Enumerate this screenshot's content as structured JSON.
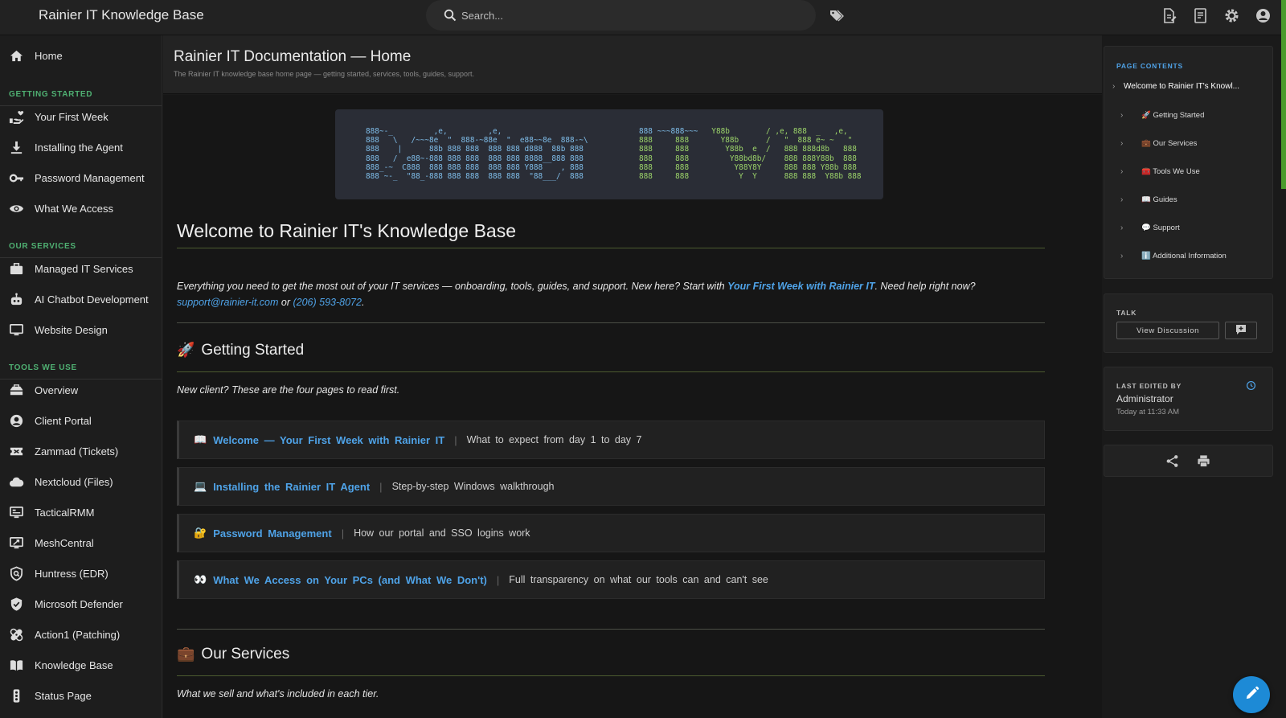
{
  "header": {
    "brand": "Rainier IT Knowledge Base",
    "search_placeholder": "Search...",
    "icons": [
      "search-icon",
      "tag-icon",
      "new-page-icon",
      "page-list-icon",
      "gear-icon",
      "account-icon"
    ]
  },
  "sidebar": {
    "home": "Home",
    "sections": [
      {
        "title": "GETTING STARTED",
        "items": [
          "Your First Week",
          "Installing the Agent",
          "Password Management",
          "What We Access"
        ]
      },
      {
        "title": "OUR SERVICES",
        "items": [
          "Managed IT Services",
          "AI Chatbot Development",
          "Website Design"
        ]
      },
      {
        "title": "TOOLS WE USE",
        "items": [
          "Overview",
          "Client Portal",
          "Zammad (Tickets)",
          "Nextcloud (Files)",
          "TacticalRMM",
          "MeshCentral",
          "Huntress (EDR)",
          "Microsoft Defender",
          "Action1 (Patching)",
          "Knowledge Base",
          "Status Page"
        ]
      }
    ]
  },
  "page": {
    "title": "Rainier IT Documentation — Home",
    "subtitle": "The Rainier IT knowledge base home page — getting started, services, tools, guides, support."
  },
  "banner": {
    "left": "888~-_         ,e,         ,e,\n888   \\   /~~~8e  \"  888-~88e  \"  e88~~8e  888-~\\\n888    |      88b 888 888  888 888 d888  88b 888\n888   /  e88~-888 888 888  888 888 8888__888 888\n888_-~  C888  888 888 888  888 888 Y888    , 888\n888 ~-_  \"88_-888 888 888  888 888  \"88___/  888",
    "right_pre": "888 ~~~888~~~",
    "right_rest": "   Y88b        / ,e, 888  _   ,e,\n888     888       Y88b      /   \"  888 e~ ~   \"\n888     888        Y88b  e  /   888 888d8b   888\n888     888         Y88bd8b/    888 888Y88b  888\n888     888          Y88Y8Y     888 888 Y88b 888\n888     888           Y  Y      888 888  Y88b 888"
  },
  "welcome": {
    "heading": "Welcome to Rainier IT's Knowledge Base",
    "intro_1": "Everything you need to get the most out of your IT services — onboarding, tools, guides, and support. New here? Start with ",
    "intro_link": "Your First Week with Rainier IT",
    "intro_2": ". Need help right now? ",
    "email": "support@rainier-it.com",
    "or": " or ",
    "phone": "(206) 593-8072",
    "period": "."
  },
  "getting_started": {
    "emoji": "🚀",
    "heading": "Getting Started",
    "lead": "New client? These are the four pages to read first.",
    "cards": [
      {
        "emoji": "📖",
        "title": "Welcome — Your First Week with Rainier IT",
        "desc": "What to expect from day 1 to day 7"
      },
      {
        "emoji": "💻",
        "title": "Installing the Rainier IT Agent",
        "desc": "Step-by-step Windows walkthrough"
      },
      {
        "emoji": "🔐",
        "title": "Password Management",
        "desc": "How our portal and SSO logins work"
      },
      {
        "emoji": "👀",
        "title": "What We Access on Your PCs (and What We Don't)",
        "desc": "Full transparency on what our tools can and can't see"
      }
    ]
  },
  "our_services": {
    "emoji": "💼",
    "heading": "Our Services",
    "lead": "What we sell and what's included in each tier."
  },
  "right_panel": {
    "toc_title": "PAGE CONTENTS",
    "toc_top": "Welcome to Rainier IT's Knowl...",
    "toc_items": [
      "🚀 Getting Started",
      "💼 Our Services",
      "🧰 Tools We Use",
      "📖 Guides",
      "💬 Support",
      "ℹ️ Additional Information"
    ],
    "talk_title": "TALK",
    "view_discussion": "View Discussion",
    "last_edited_title": "LAST EDITED BY",
    "last_edited_name": "Administrator",
    "last_edited_time": "Today at 11:33 AM"
  }
}
